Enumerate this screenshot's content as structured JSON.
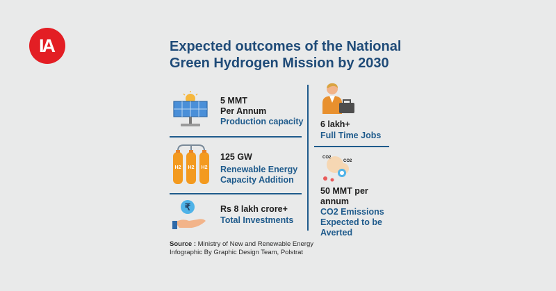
{
  "logo": {
    "text": "IA"
  },
  "title": {
    "line1": "Expected outcomes of the National",
    "line2": "Green Hydrogen Mission by 2030"
  },
  "stats": [
    {
      "value": "5 MMT",
      "value2": "Per Annum",
      "label": "Production capacity",
      "icon": "solar-panel-icon"
    },
    {
      "value": "125 GW",
      "label1": "Renewable Energy",
      "label2": "Capacity Addition",
      "icon": "hydrogen-cylinders-icon"
    },
    {
      "value": "Rs 8 lakh crore+",
      "label": "Total Investments",
      "icon": "rupee-hand-icon"
    },
    {
      "value": "6 lakh+",
      "label": "Full Time Jobs",
      "icon": "worker-briefcase-icon"
    },
    {
      "value1": "50 MMT per",
      "value2": "annum",
      "label1": "CO2 Emissions",
      "label2": "Expected to be",
      "label3": "Averted",
      "icon": "co2-cloud-icon"
    }
  ],
  "co2_tags": {
    "a": "CO2",
    "b": "CO2"
  },
  "cylinder_label": "H2",
  "rupee_symbol": "₹",
  "source": {
    "prefix": "Source :",
    "line1": "Ministry of New and Renewable Energy",
    "line2": "Infographic By Graphic Design Team, Polstrat"
  },
  "colors": {
    "title": "#1f4b78",
    "accent": "#1f5b8c",
    "logo": "#e31e24",
    "background": "#e9eaea"
  }
}
